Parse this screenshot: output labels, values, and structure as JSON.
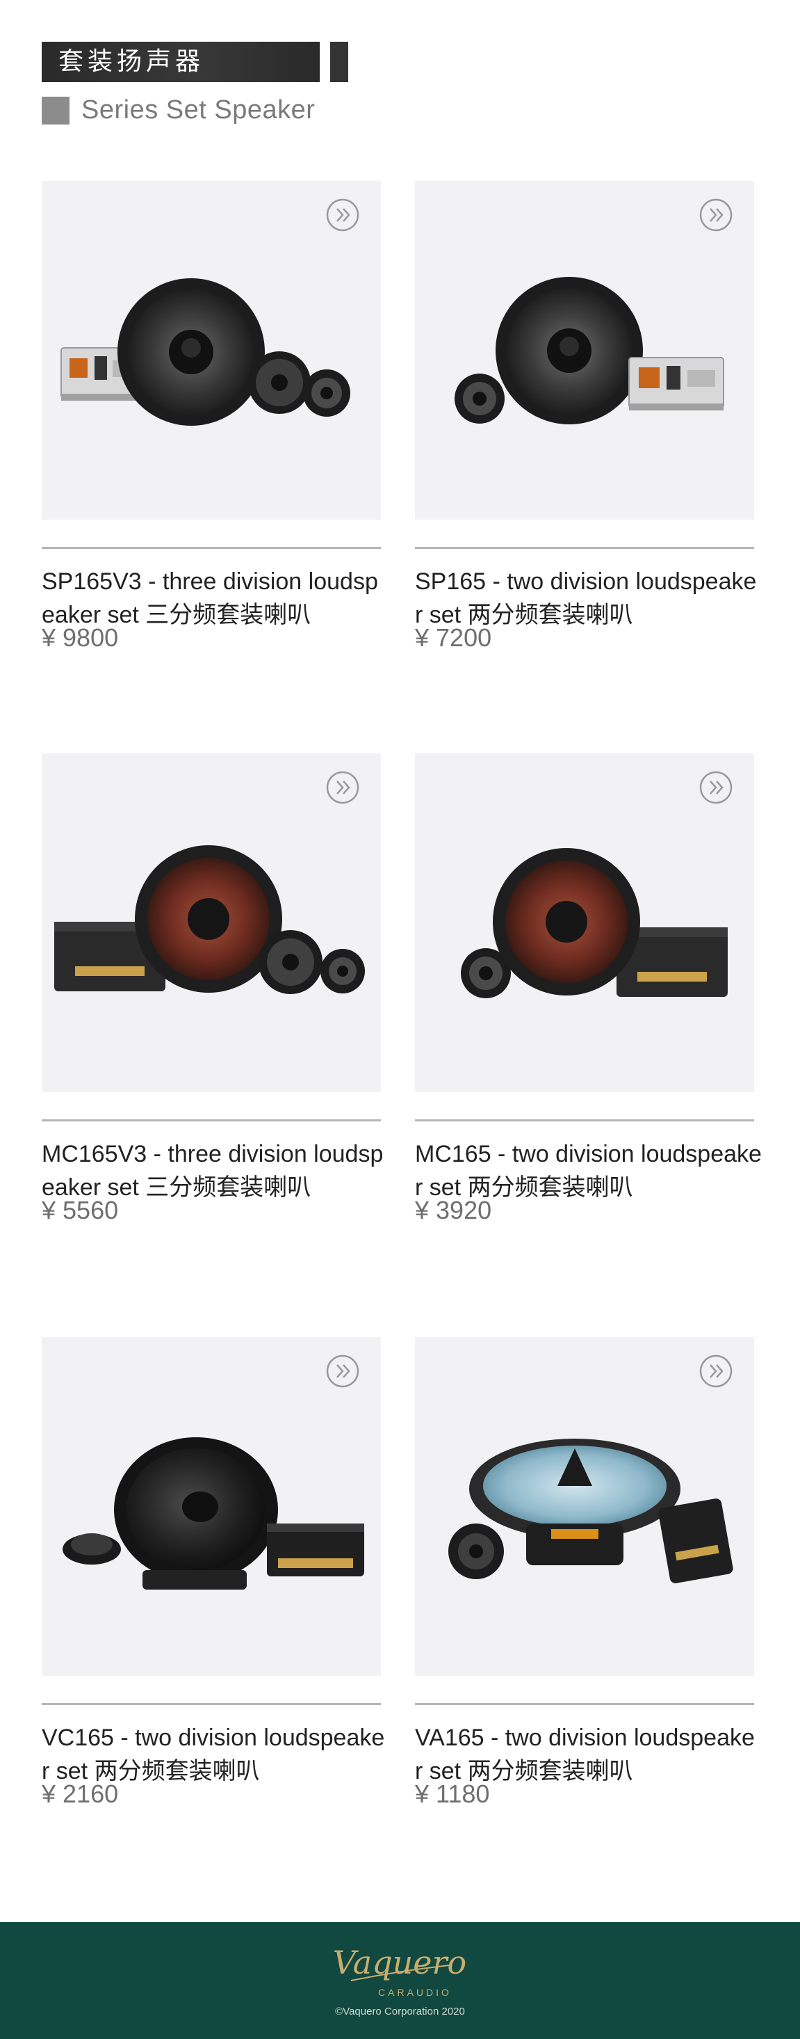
{
  "header": {
    "title_cn": "套装扬声器",
    "subtitle_en": "Series Set Speaker"
  },
  "products": [
    {
      "name": "SP165V3 - three division loudspeaker set  三分频套装喇叭",
      "price": "¥ 9800"
    },
    {
      "name": "SP165 - two division loudspeaker set  两分频套装喇叭",
      "price": "¥ 7200"
    },
    {
      "name": "MC165V3 - three division loudspeaker set  三分频套装喇叭",
      "price": "¥ 5560"
    },
    {
      "name": "MC165 - two division loudspeaker set  两分频套装喇叭",
      "price": "¥ 3920"
    },
    {
      "name": "VC165 - two division loudspeaker set  两分频套装喇叭",
      "price": "¥ 2160"
    },
    {
      "name": "VA165 - two division loudspeaker set  两分频套装喇叭",
      "price": "¥ 1180"
    }
  ],
  "icons": {
    "more": "double-chevron-right-icon"
  },
  "footer": {
    "brand": "Vaquero",
    "brand_sub": "CARAUDIO",
    "copyright": "©Vaquero Corporation 2020"
  },
  "colors": {
    "footer_bg": "#11483f",
    "logo_gold": "#c9ad6f",
    "card_bg": "#f2f2f4"
  }
}
